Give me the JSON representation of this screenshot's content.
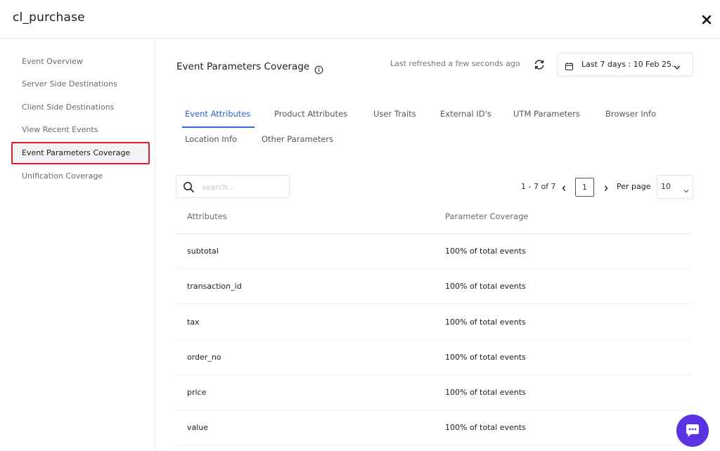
{
  "header": {
    "title": "cl_purchase"
  },
  "sidebar": {
    "items": [
      {
        "label": "Event Overview",
        "active": false
      },
      {
        "label": "Server Side Destinations",
        "active": false
      },
      {
        "label": "Client Side Destinations",
        "active": false
      },
      {
        "label": "View Recent Events",
        "active": false
      },
      {
        "label": "Event Parameters Coverage",
        "active": true
      },
      {
        "label": "Unification Coverage",
        "active": false
      }
    ]
  },
  "main": {
    "title": "Event Parameters Coverage",
    "refresh_text": "Last refreshed a few seconds ago",
    "date_range": "Last 7 days : 10 Feb 25...",
    "tabs": [
      {
        "label": "Event Attributes",
        "active": true
      },
      {
        "label": "Product Attributes",
        "active": false
      },
      {
        "label": "User Traits",
        "active": false
      },
      {
        "label": "External ID's",
        "active": false
      },
      {
        "label": "UTM Parameters",
        "active": false
      },
      {
        "label": "Browser Info",
        "active": false
      },
      {
        "label": "Location Info",
        "active": false
      },
      {
        "label": "Other Parameters",
        "active": false
      }
    ]
  },
  "search": {
    "placeholder": "search..."
  },
  "pagination": {
    "range": "1 - 7 of 7",
    "page": "1",
    "per_page_label": "Per page",
    "per_page_value": "10"
  },
  "table": {
    "columns": [
      "Attributes",
      "Parameter Coverage"
    ],
    "rows": [
      {
        "attribute": "subtotal",
        "coverage": "100% of total events"
      },
      {
        "attribute": "transaction_id",
        "coverage": "100% of total events"
      },
      {
        "attribute": "tax",
        "coverage": "100% of total events"
      },
      {
        "attribute": "order_no",
        "coverage": "100% of total events"
      },
      {
        "attribute": "price",
        "coverage": "100% of total events"
      },
      {
        "attribute": "value",
        "coverage": "100% of total events"
      }
    ]
  },
  "icons": {
    "close": "close-icon",
    "info": "info-icon",
    "refresh": "refresh-icon",
    "calendar": "calendar-icon",
    "chevron": "chevron-down-icon",
    "search": "search-icon",
    "chat": "chat-icon"
  },
  "colors": {
    "accent": "#2b63c9",
    "active_outline": "#d61f2a",
    "chat": "#5a34e0"
  }
}
